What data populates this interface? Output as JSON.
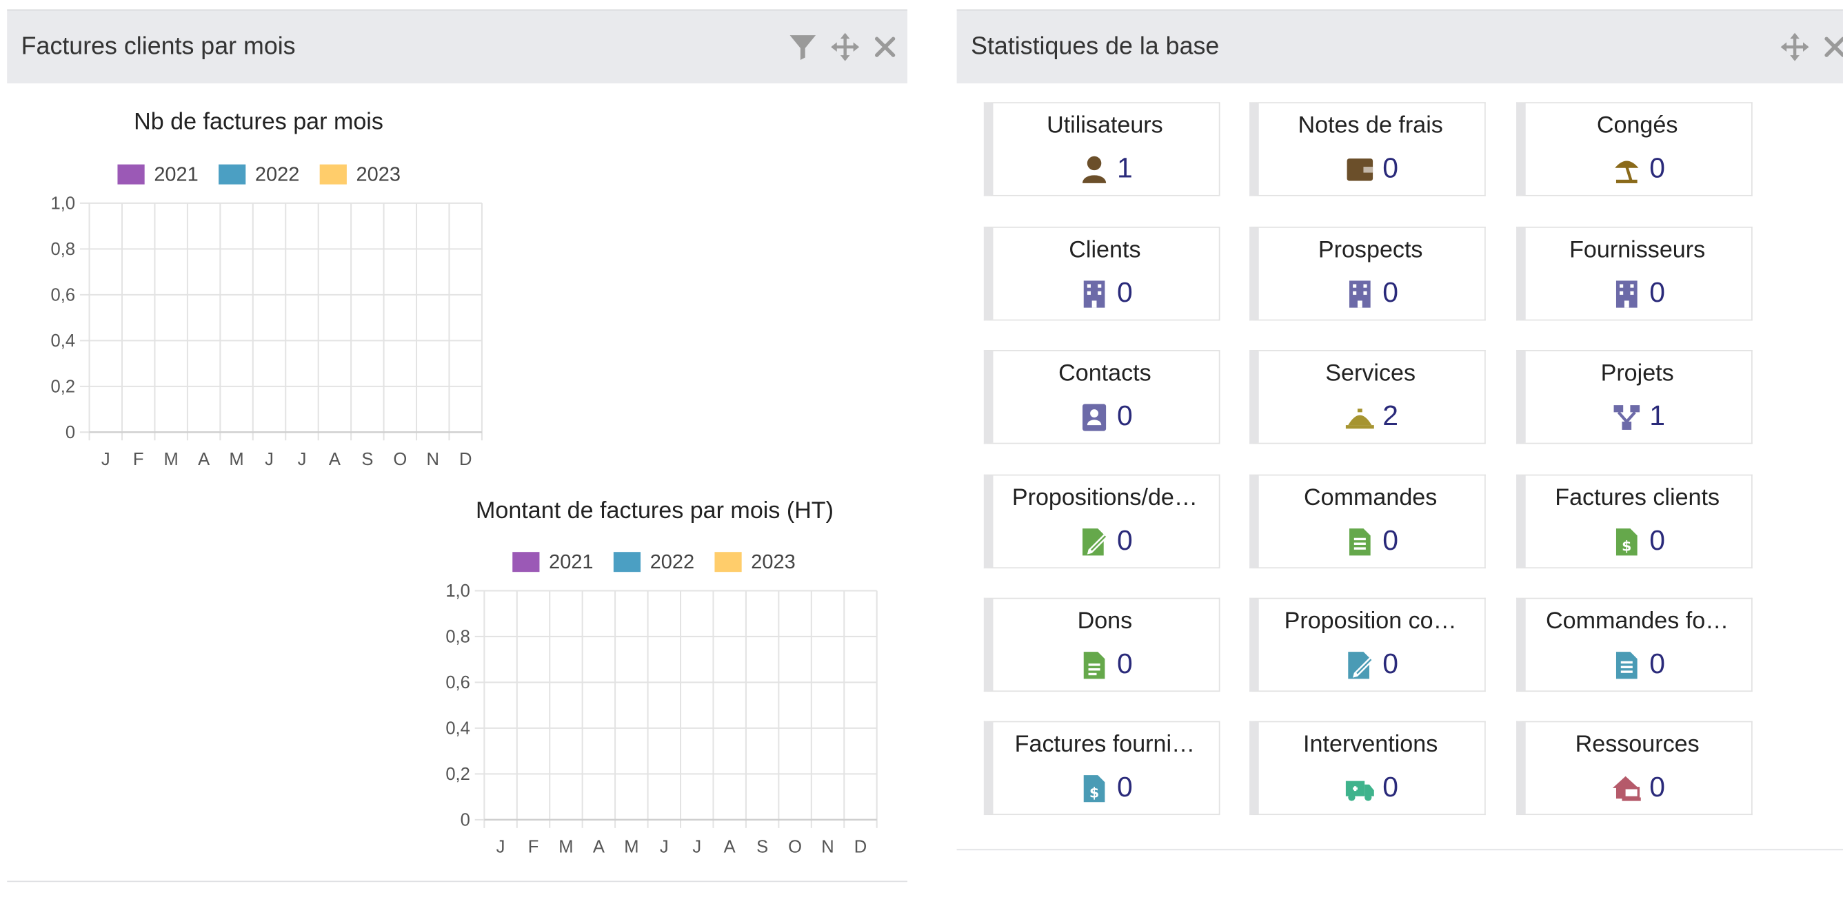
{
  "left_panel": {
    "title": "Factures clients par mois",
    "icons": [
      "filter-icon",
      "move-icon",
      "close-icon"
    ]
  },
  "right_panel": {
    "title": "Statistiques de la base",
    "icons": [
      "move-icon",
      "close-icon"
    ]
  },
  "chart_data": [
    {
      "type": "bar",
      "title": "Nb de factures par mois",
      "categories": [
        "J",
        "F",
        "M",
        "A",
        "M",
        "J",
        "J",
        "A",
        "S",
        "O",
        "N",
        "D"
      ],
      "series": [
        {
          "name": "2021",
          "color": "#9b59b6",
          "values": [
            0,
            0,
            0,
            0,
            0,
            0,
            0,
            0,
            0,
            0,
            0,
            0
          ]
        },
        {
          "name": "2022",
          "color": "#4b9fc3",
          "values": [
            0,
            0,
            0,
            0,
            0,
            0,
            0,
            0,
            0,
            0,
            0,
            0
          ]
        },
        {
          "name": "2023",
          "color": "#ffcd6b",
          "values": [
            0,
            0,
            0,
            0,
            0,
            0,
            0,
            0,
            0,
            0,
            0,
            0
          ]
        }
      ],
      "yticks": [
        "0",
        "0,2",
        "0,4",
        "0,6",
        "0,8",
        "1,0"
      ],
      "ylim": [
        0,
        1
      ],
      "grid": true,
      "legend": "top"
    },
    {
      "type": "bar",
      "title": "Montant de factures par mois (HT)",
      "categories": [
        "J",
        "F",
        "M",
        "A",
        "M",
        "J",
        "J",
        "A",
        "S",
        "O",
        "N",
        "D"
      ],
      "series": [
        {
          "name": "2021",
          "color": "#9b59b6",
          "values": [
            0,
            0,
            0,
            0,
            0,
            0,
            0,
            0,
            0,
            0,
            0,
            0
          ]
        },
        {
          "name": "2022",
          "color": "#4b9fc3",
          "values": [
            0,
            0,
            0,
            0,
            0,
            0,
            0,
            0,
            0,
            0,
            0,
            0
          ]
        },
        {
          "name": "2023",
          "color": "#ffcd6b",
          "values": [
            0,
            0,
            0,
            0,
            0,
            0,
            0,
            0,
            0,
            0,
            0,
            0
          ]
        }
      ],
      "yticks": [
        "0",
        "0,2",
        "0,4",
        "0,6",
        "0,8",
        "1,0"
      ],
      "ylim": [
        0,
        1
      ],
      "grid": true,
      "legend": "top"
    }
  ],
  "stats": [
    {
      "label": "Utilisateurs",
      "value": "1",
      "icon": "user-icon",
      "color": "#6b4f2a"
    },
    {
      "label": "Notes de frais",
      "value": "0",
      "icon": "wallet-icon",
      "color": "#6b4f2a"
    },
    {
      "label": "Congés",
      "value": "0",
      "icon": "umbrella-beach-icon",
      "color": "#8a6a1a"
    },
    {
      "label": "Clients",
      "value": "0",
      "icon": "building-icon",
      "color": "#6c6aa8"
    },
    {
      "label": "Prospects",
      "value": "0",
      "icon": "building-icon",
      "color": "#6c6aa8"
    },
    {
      "label": "Fournisseurs",
      "value": "0",
      "icon": "building-icon",
      "color": "#6c6aa8"
    },
    {
      "label": "Contacts",
      "value": "0",
      "icon": "address-book-icon",
      "color": "#6c6aa8"
    },
    {
      "label": "Services",
      "value": "2",
      "icon": "bell-concierge-icon",
      "color": "#a69430"
    },
    {
      "label": "Projets",
      "value": "1",
      "icon": "sitemap-icon",
      "color": "#6c6aa8"
    },
    {
      "label": "Propositions/de…",
      "value": "0",
      "icon": "file-signature-icon",
      "color": "#65a84b"
    },
    {
      "label": "Commandes",
      "value": "0",
      "icon": "file-text-icon",
      "color": "#65a84b"
    },
    {
      "label": "Factures clients",
      "value": "0",
      "icon": "file-invoice-dollar-icon",
      "color": "#65a84b"
    },
    {
      "label": "Dons",
      "value": "0",
      "icon": "file-alt-icon",
      "color": "#65a84b"
    },
    {
      "label": "Proposition co…",
      "value": "0",
      "icon": "file-signature-icon",
      "color": "#4a9bb5"
    },
    {
      "label": "Commandes fo…",
      "value": "0",
      "icon": "file-text-icon",
      "color": "#4a9bb5"
    },
    {
      "label": "Factures fourni…",
      "value": "0",
      "icon": "file-invoice-dollar-icon",
      "color": "#4a9bb5"
    },
    {
      "label": "Interventions",
      "value": "0",
      "icon": "ambulance-icon",
      "color": "#3fb38c"
    },
    {
      "label": "Ressources",
      "value": "0",
      "icon": "house-laptop-icon",
      "color": "#b55a6a"
    }
  ]
}
